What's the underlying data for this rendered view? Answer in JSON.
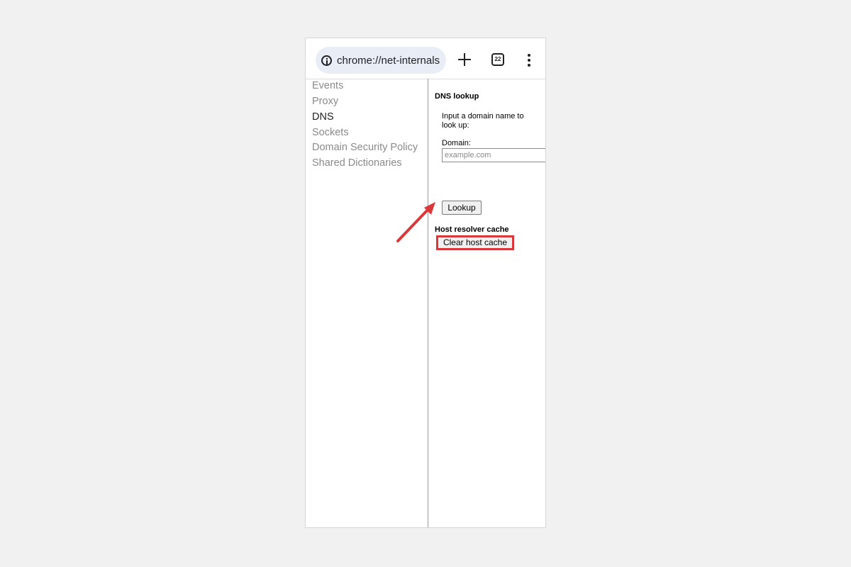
{
  "browser": {
    "url": "chrome://net-internals",
    "tab_count": "22"
  },
  "sidebar": {
    "items": [
      {
        "label": "Events"
      },
      {
        "label": "Proxy"
      },
      {
        "label": "DNS"
      },
      {
        "label": "Sockets"
      },
      {
        "label": "Domain Security Policy"
      },
      {
        "label": "Shared Dictionaries"
      }
    ]
  },
  "dns_lookup": {
    "title": "DNS lookup",
    "instructions_line1": "Input a domain name to",
    "instructions_line2": "look up:",
    "domain_label": "Domain:",
    "domain_placeholder": "example.com",
    "lookup_button": "Lookup"
  },
  "host_cache": {
    "title": "Host resolver cache",
    "clear_button": "Clear host cache"
  },
  "colors": {
    "highlight": "#d9393b",
    "omnibox_bg": "#e9eef6",
    "inactive_nav": "#8a8a8a"
  }
}
